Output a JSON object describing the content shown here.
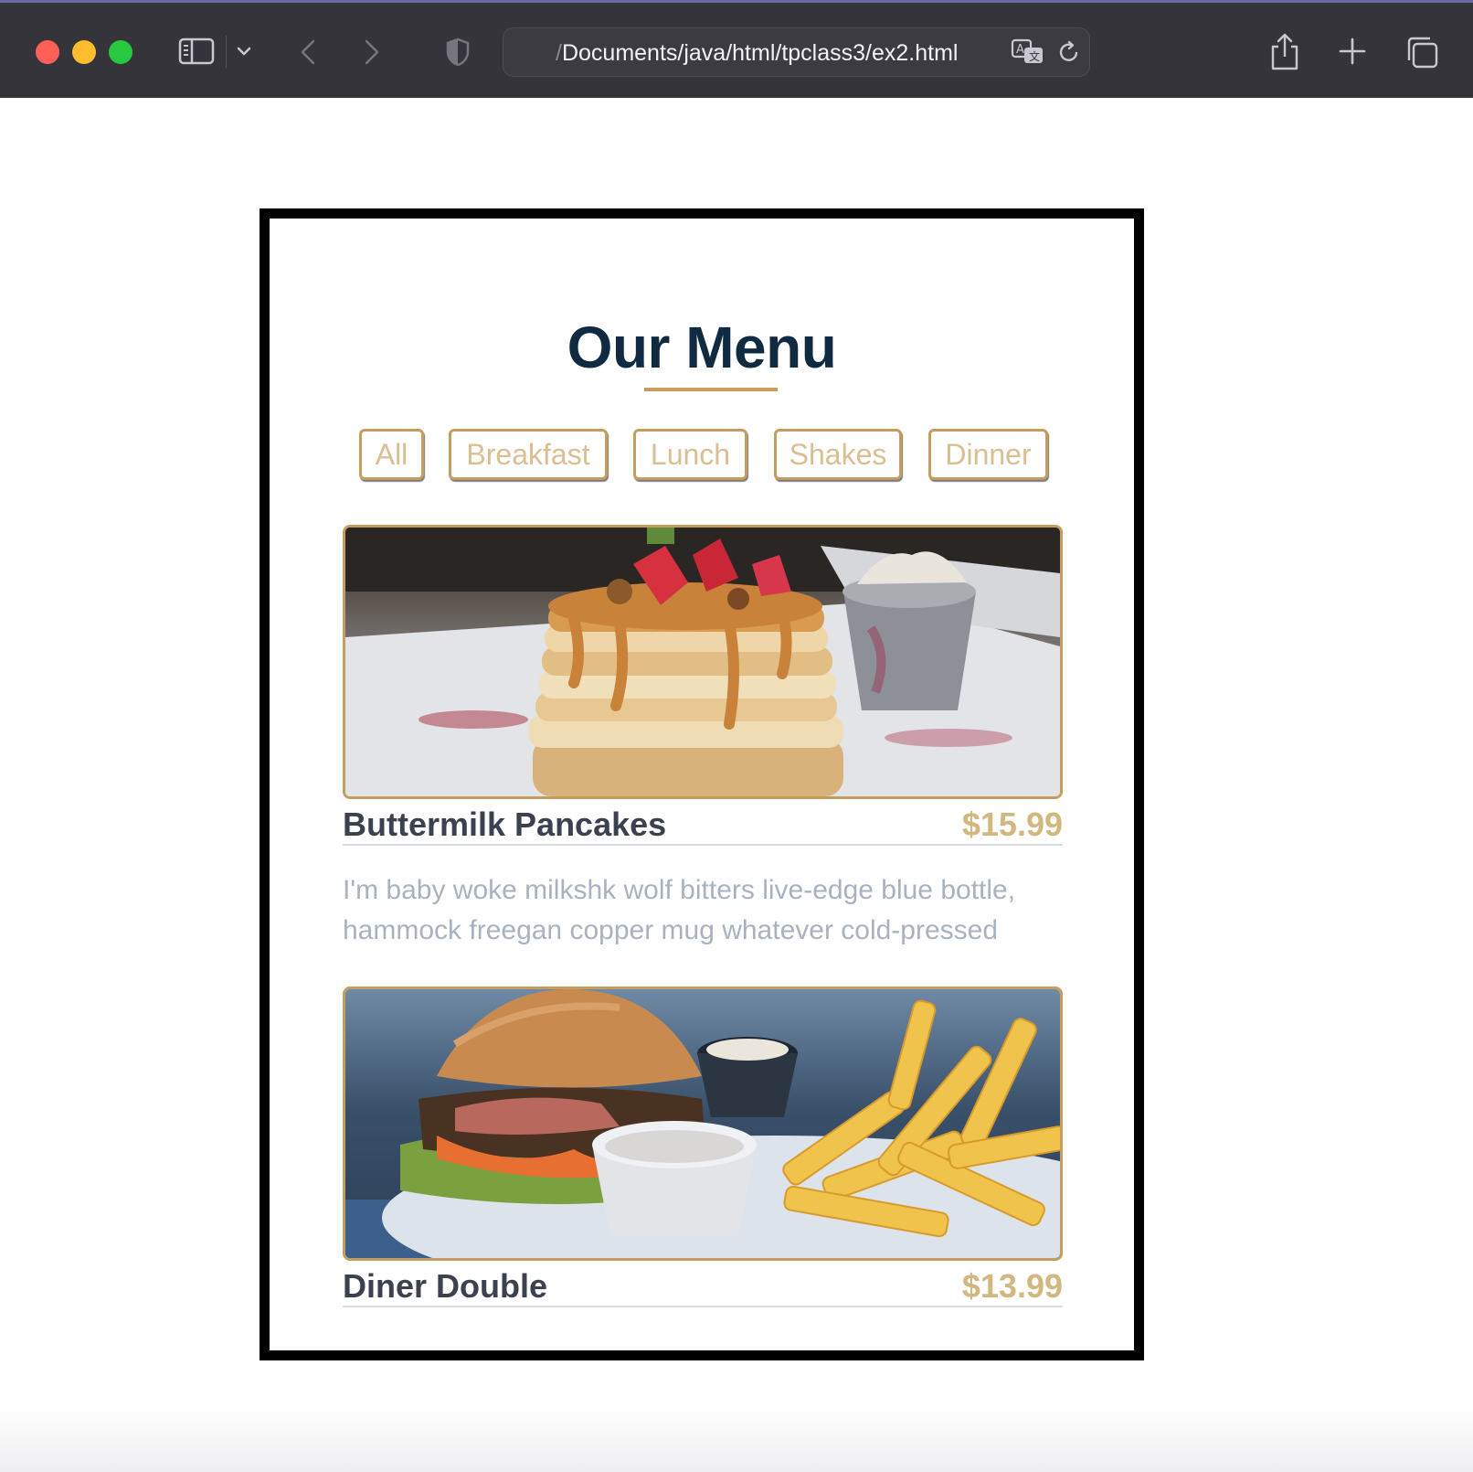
{
  "browser": {
    "url_prefix": "/",
    "url_text": "Documents/java/html/tpclass3/ex2.html"
  },
  "page": {
    "title": "Our Menu",
    "filters": [
      "All",
      "Breakfast",
      "Lunch",
      "Shakes",
      "Dinner"
    ],
    "items": [
      {
        "name": "Buttermilk Pancakes",
        "price": "$15.99",
        "description": "I'm baby woke milkshk wolf bitters live-edge blue bottle, hammock freegan copper mug whatever cold-pressed",
        "image": "pancake-stack-photo"
      },
      {
        "name": "Diner Double",
        "price": "$13.99",
        "description": "",
        "image": "burger-and-fries-photo"
      }
    ]
  },
  "colors": {
    "accent": "#c59d5f",
    "title": "#102a42",
    "price": "#d2b77f",
    "description": "#a9b2c0"
  }
}
